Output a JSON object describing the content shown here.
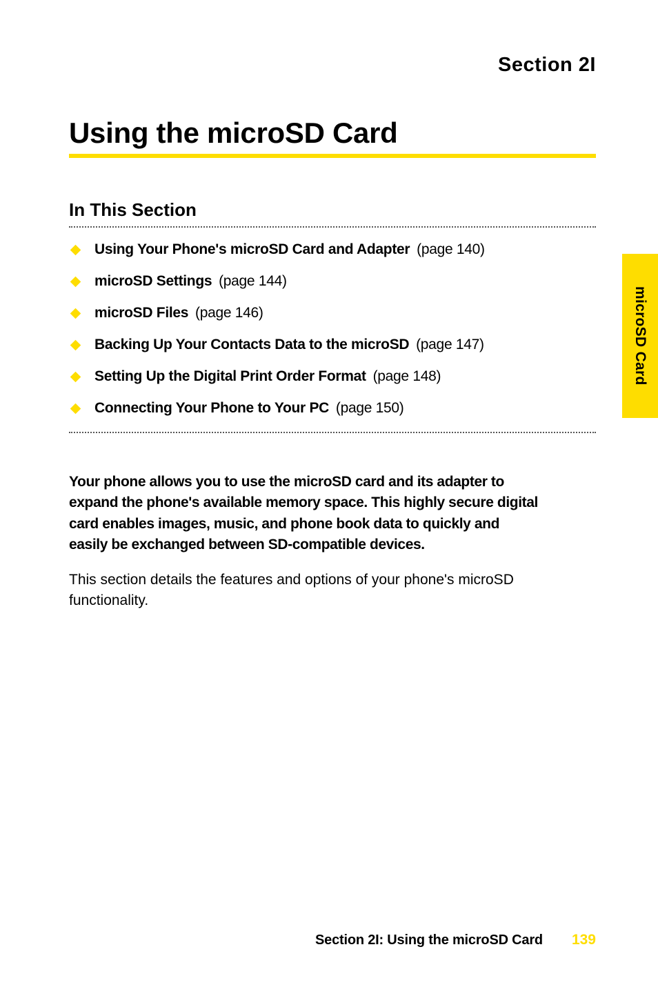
{
  "header": {
    "section_label": "Section 2I"
  },
  "title": "Using the microSD Card",
  "subhead": "In This Section",
  "toc": [
    {
      "label": "Using Your Phone's microSD Card and Adapter",
      "page": "(page 140)"
    },
    {
      "label": "microSD Settings",
      "page": "(page 144)"
    },
    {
      "label": "microSD Files",
      "page": "(page 146)"
    },
    {
      "label": "Backing Up Your Contacts Data to the microSD",
      "page": "(page 147)"
    },
    {
      "label": "Setting Up the Digital Print Order Format",
      "page": "(page 148)"
    },
    {
      "label": "Connecting Your Phone to Your PC",
      "page": "(page 150)"
    }
  ],
  "intro": "Your phone allows you to use the microSD card and its adapter to expand the phone's available memory space. This highly secure digital card enables images, music, and phone book data to quickly and easily be exchanged between SD-compatible devices.",
  "body": "This section details the features and options of your phone's microSD functionality.",
  "side_tab": "microSD Card",
  "footer": {
    "section": "Section 2I: Using the microSD Card",
    "page": "139"
  }
}
